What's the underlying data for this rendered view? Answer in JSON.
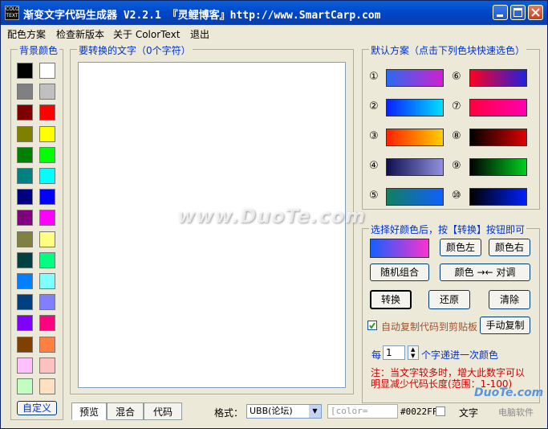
{
  "window": {
    "title": "渐变文字代码生成器 V2.2.1 『灵鲤博客』http://www.SmartCarp.com",
    "icon_text": "COLOR TEXT"
  },
  "menu": [
    "配色方案",
    "检查新版本",
    "关于 ColorText",
    "退出"
  ],
  "background_panel": {
    "title": "背景颜色",
    "swatches_left": [
      "#000000",
      "#808080",
      "#800000",
      "#808000",
      "#008000",
      "#008080",
      "#000080",
      "#800080",
      "#808040",
      "#004040",
      "#0080ff",
      "#004080",
      "#8000ff",
      "#804000",
      "#ffc0ff",
      "#c0ffc0"
    ],
    "swatches_right": [
      "#ffffff",
      "#c0c0c0",
      "#ff0000",
      "#ffff00",
      "#00ff00",
      "#00ffff",
      "#0000ff",
      "#ff00ff",
      "#ffff80",
      "#00ff80",
      "#80ffff",
      "#8080ff",
      "#ff0080",
      "#ff8040",
      "#ffc0c0",
      "#ffe0c0"
    ],
    "custom_label": "自定义"
  },
  "text_panel": {
    "title": "要转换的文字（0个字符）",
    "value": ""
  },
  "schemes_panel": {
    "title": "默认方案（点击下列色块快速选色）",
    "left": [
      {
        "num": "①",
        "colors": [
          "#2a6af0",
          "#d020d0"
        ]
      },
      {
        "num": "②",
        "colors": [
          "#0a20ff",
          "#00e0ff"
        ]
      },
      {
        "num": "③",
        "colors": [
          "#ff2000",
          "#ffd000"
        ]
      },
      {
        "num": "④",
        "colors": [
          "#101050",
          "#9090e0"
        ]
      },
      {
        "num": "⑤",
        "colors": [
          "#108060",
          "#1060ff"
        ]
      }
    ],
    "right": [
      {
        "num": "⑥",
        "colors": [
          "#ff0020",
          "#2020e0"
        ]
      },
      {
        "num": "⑦",
        "colors": [
          "#ff0040",
          "#ff00b0"
        ]
      },
      {
        "num": "⑧",
        "colors": [
          "#000000",
          "#e00000"
        ]
      },
      {
        "num": "⑨",
        "colors": [
          "#000000",
          "#00d020"
        ]
      },
      {
        "num": "⑩",
        "colors": [
          "#000000",
          "#0020ff"
        ]
      }
    ]
  },
  "convert_panel": {
    "title": "选择好颜色后，按【转换】按钮即可",
    "current_colors": [
      "#1560ff",
      "#ff30d0"
    ],
    "color_left": "颜色左",
    "color_right": "颜色右",
    "random": "随机组合",
    "swap": "颜色 →← 对调",
    "convert": "转换",
    "restore": "还原",
    "clear": "清除",
    "auto_copy_label": "自动复制代码到剪贴板",
    "auto_copy_checked": true,
    "manual_copy": "手动复制",
    "every_prefix": "每",
    "every_value": "1",
    "every_suffix": "个字递进一次颜色",
    "note_line1": "注：当文字较多时，增大此数字可以",
    "note_line2": "明显减少代码长度(范围：1-100)"
  },
  "bottom": {
    "tabs": [
      "预览",
      "混合",
      "代码"
    ],
    "format_label": "格式：",
    "format_value": "UBB(论坛)",
    "code_preview": "[color=",
    "color_code": "#0022FF",
    "text_label": "文字",
    "site_text": "电脑软件"
  },
  "watermark": "www.DuoTe.com",
  "watermark2": "DuoTe.com"
}
